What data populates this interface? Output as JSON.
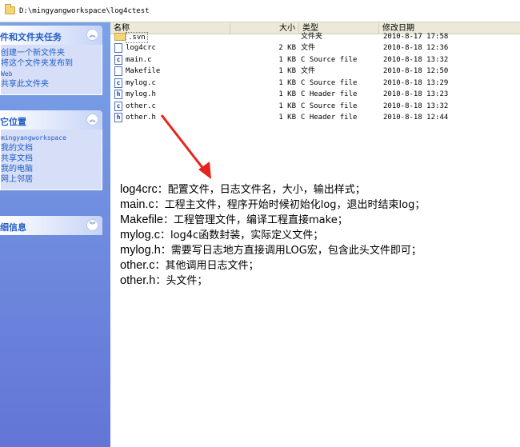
{
  "address": {
    "path": "D:\\mingyangworkspace\\log4ctest"
  },
  "taskpane": {
    "file_tasks": {
      "title": "件和文件夹任务",
      "items": [
        "创建一个新文件夹",
        "将这个文件夹发布到",
        "Web",
        "共享此文件夹"
      ]
    },
    "other_places": {
      "title": "它位置",
      "items": [
        "mingyangworkspace",
        "我的文档",
        "共享文档",
        "我的电脑",
        "网上邻居"
      ]
    },
    "details": {
      "title": "细信息"
    },
    "collapse_glyph": "︽",
    "expand_glyph": "︾"
  },
  "columns": {
    "name": "名称",
    "size": "大小",
    "type": "类型",
    "date": "修改日期"
  },
  "files": [
    {
      "name": ".svn",
      "size": "",
      "type": "文件夹",
      "date": "2010-8-17 17:58",
      "icon": "folder"
    },
    {
      "name": "log4crc",
      "size": "2 KB",
      "type": "文件",
      "date": "2010-8-18 12:36",
      "icon": "file"
    },
    {
      "name": "main.c",
      "size": "1 KB",
      "type": "C Source file",
      "date": "2010-8-18 13:32",
      "icon": "c-file"
    },
    {
      "name": "Makefile",
      "size": "1 KB",
      "type": "文件",
      "date": "2010-8-18 12:50",
      "icon": "file"
    },
    {
      "name": "mylog.c",
      "size": "1 KB",
      "type": "C Source file",
      "date": "2010-8-18 13:29",
      "icon": "c-file"
    },
    {
      "name": "mylog.h",
      "size": "1 KB",
      "type": "C Header file",
      "date": "2010-8-18 13:23",
      "icon": "h-file"
    },
    {
      "name": "other.c",
      "size": "1 KB",
      "type": "C Source file",
      "date": "2010-8-18 13:32",
      "icon": "c-file"
    },
    {
      "name": "other.h",
      "size": "1 KB",
      "type": "C Header file",
      "date": "2010-8-18 12:44",
      "icon": "h-file"
    }
  ],
  "annotations": [
    {
      "file": "log4crc",
      "desc": "：配置文件，日志文件名，大小，输出样式；"
    },
    {
      "file": "main.c",
      "desc": "：工程主文件，程序开始时候初始化log，退出时结束log；"
    },
    {
      "file": "Makefile",
      "desc": "：工程管理文件，编译工程直接make；"
    },
    {
      "file": "mylog.c",
      "desc": "：log4c函数封装，实际定义文件；"
    },
    {
      "file": "mylog.h",
      "desc": "：需要写日志地方直接调用LOG宏，包含此头文件即可；"
    },
    {
      "file": "other.c",
      "desc": "：其他调用日志文件；"
    },
    {
      "file": "other.h",
      "desc": "：头文件；"
    }
  ],
  "colors": {
    "arrow": "#e8231c",
    "link": "#215dc6",
    "pane": "#6f8ee0"
  }
}
